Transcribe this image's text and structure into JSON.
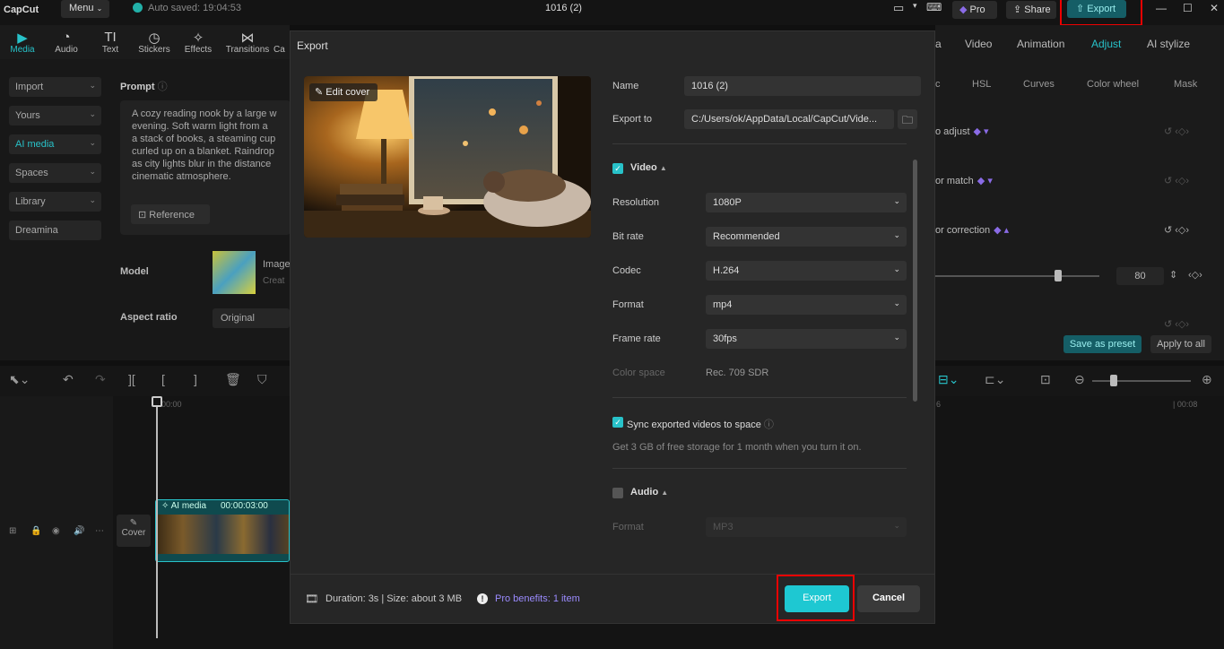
{
  "app": {
    "logo": "CapCut",
    "menu_label": "Menu",
    "autosave": "Auto saved: 19:04:53",
    "project_title": "1016 (2)",
    "pro_label": "Pro",
    "share_label": "Share",
    "export_label": "Export"
  },
  "toolbar": {
    "tools": [
      {
        "label": "Media",
        "icon": "media-icon"
      },
      {
        "label": "Audio",
        "icon": "audio-icon"
      },
      {
        "label": "Text",
        "icon": "text-icon"
      },
      {
        "label": "Stickers",
        "icon": "stickers-icon"
      },
      {
        "label": "Effects",
        "icon": "effects-icon"
      },
      {
        "label": "Transitions",
        "icon": "transitions-icon"
      },
      {
        "label": "Ca",
        "icon": "captions-icon"
      }
    ]
  },
  "sidebar": {
    "items": [
      {
        "label": "Import"
      },
      {
        "label": "Yours"
      },
      {
        "label": "AI media"
      },
      {
        "label": "Spaces"
      },
      {
        "label": "Library"
      },
      {
        "label": "Dreamina"
      }
    ]
  },
  "prompt": {
    "label": "Prompt",
    "text": "A cozy reading nook by a large w\nevening. Soft warm light from a\na stack of books, a steaming cup\ncurled up on a blanket. Raindrop\nas city lights blur in the distance\ncinematic atmosphere.",
    "reference_label": "Reference"
  },
  "model": {
    "label": "Model",
    "name": "Image",
    "sub": "Creat"
  },
  "aspect": {
    "label": "Aspect ratio",
    "value": "Original"
  },
  "right_panel": {
    "tabs": [
      {
        "label": "a"
      },
      {
        "label": "Video"
      },
      {
        "label": "Animation"
      },
      {
        "label": "Adjust"
      },
      {
        "label": "AI stylize"
      }
    ],
    "subtabs": [
      {
        "label": "c"
      },
      {
        "label": "HSL"
      },
      {
        "label": "Curves"
      },
      {
        "label": "Color wheel"
      },
      {
        "label": "Mask"
      }
    ],
    "rows": [
      {
        "label": "o adjust"
      },
      {
        "label": "or match"
      },
      {
        "label": "or correction"
      }
    ],
    "slider_value": "80",
    "save_preset": "Save as preset",
    "apply_all": "Apply to all"
  },
  "timeline": {
    "ruler_start": "00:00",
    "ruler_end": "| 00:08",
    "ruler_mid": "6",
    "cover_label": "Cover",
    "clip_label": "AI media",
    "clip_time": "00:00:03:00"
  },
  "dialog": {
    "title": "Export",
    "edit_cover": "Edit cover",
    "name_label": "Name",
    "name_value": "1016 (2)",
    "export_to_label": "Export to",
    "export_to_value": "C:/Users/ok/AppData/Local/CapCut/Vide...",
    "video_section": "Video",
    "resolution_label": "Resolution",
    "resolution_value": "1080P",
    "bitrate_label": "Bit rate",
    "bitrate_value": "Recommended",
    "codec_label": "Codec",
    "codec_value": "H.264",
    "format_label": "Format",
    "format_value": "mp4",
    "framerate_label": "Frame rate",
    "framerate_value": "30fps",
    "colorspace_label": "Color space",
    "colorspace_value": "Rec. 709 SDR",
    "sync_label": "Sync exported videos to space",
    "sync_note": "Get 3 GB of free storage for 1 month when you turn it on.",
    "audio_section": "Audio",
    "audio_format_label": "Format",
    "audio_format_value": "MP3",
    "footer_info": "Duration: 3s | Size: about 3 MB",
    "pro_benefits": "Pro benefits: 1 item",
    "export_button": "Export",
    "cancel_button": "Cancel"
  }
}
